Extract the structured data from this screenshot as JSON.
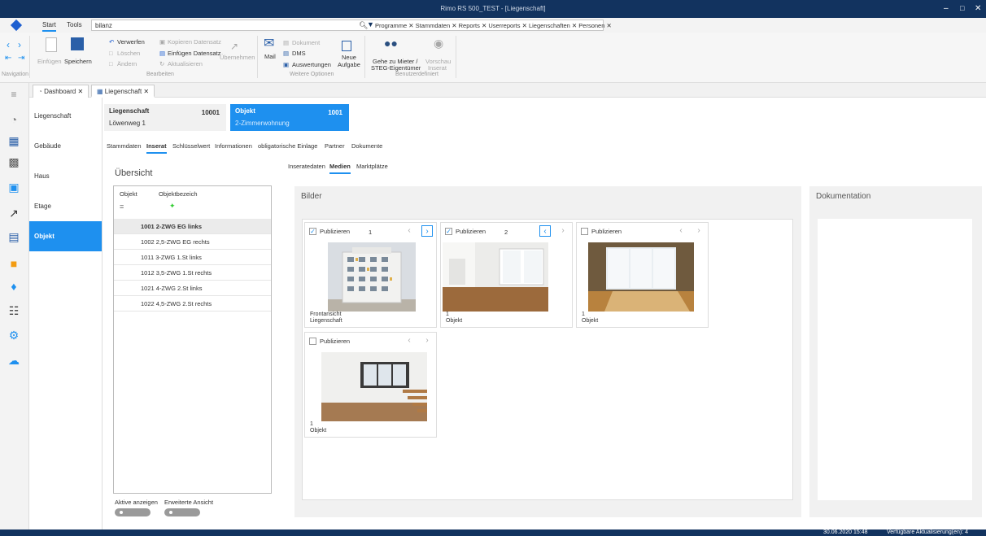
{
  "window": {
    "title": "Rimo RS 500_TEST - [Liegenschaft]",
    "controls": [
      "–",
      "□",
      "✕"
    ]
  },
  "menu": {
    "tabs": [
      "Start",
      "Tools"
    ],
    "search_value": "bilanz",
    "filters": "Programme ✕ Stammdaten ✕ Reports ✕ Userreports ✕ Liegenschaften ✕ Personen ✕"
  },
  "ribbon": {
    "navigation_group": "Navigation",
    "einfuegen": "Einfügen",
    "speichern": "Speichern",
    "verwerfen": "Verwerfen",
    "loeschen": "Löschen",
    "aendern": "Ändern",
    "kopieren": "Kopieren Datensatz",
    "einfuegen_datensatz": "Einfügen Datensatz",
    "aktualisieren": "Aktualisieren",
    "bearbeiten_group": "Bearbeiten",
    "uebernehmen": "Übernehmen",
    "mail": "Mail",
    "dokument": "Dokument",
    "dms": "DMS",
    "auswertungen": "Auswertungen",
    "neue": "Neue",
    "aufgabe": "Aufgabe",
    "weitere_group": "Weitere Optionen",
    "gehe_zu": "Gehe zu Mieter /",
    "steg": "STEG-Eigentümer",
    "vorschau": "Vorschau",
    "inserat": "Inserat",
    "benutzer_group": "Benutzerdefiniert"
  },
  "doctabs": [
    {
      "label": "Dashboard"
    },
    {
      "label": "Liegenschaft"
    }
  ],
  "nav": [
    {
      "label": "Liegenschaft"
    },
    {
      "label": "Gebäude"
    },
    {
      "label": "Haus"
    },
    {
      "label": "Etage"
    },
    {
      "label": "Objekt"
    }
  ],
  "header": {
    "liegenschaft_title": "Liegenschaft",
    "liegenschaft_num": "10001",
    "liegenschaft_sub": "Löwenweg 1",
    "objekt_title": "Objekt",
    "objekt_num": "1001",
    "objekt_sub": "2-Zimmerwohnung"
  },
  "subtabs": [
    "Stammdaten",
    "Inserat",
    "Schlüsselwert",
    "Informationen",
    "obligatorische Einlage",
    "Partner",
    "Dokumente"
  ],
  "subtabs2": [
    "Inseratedaten",
    "Medien",
    "Marktplätze"
  ],
  "overview": {
    "title": "Übersicht",
    "col1": "Objekt",
    "col2": "Objektbezeich",
    "rows": [
      "1001 2-ZWG EG links",
      "1002 2,5-ZWG EG rechts",
      "1011 3-ZWG 1.St links",
      "1012 3,5-ZWG 1.St rechts",
      "1021 4-ZWG 2.St links",
      "1022 4,5-ZWG 2.St rechts"
    ],
    "aktive": "Aktive anzeigen",
    "erweiterte": "Erweiterte Ansicht"
  },
  "bilder": {
    "title": "Bilder",
    "cards": [
      {
        "pub": "Publizieren",
        "num": "1",
        "checked": "✓",
        "cap1": "Frontansicht",
        "cap2": "Liegenschaft"
      },
      {
        "pub": "Publizieren",
        "num": "2",
        "checked": "✓",
        "cap1": "1",
        "cap2": "Objekt"
      },
      {
        "pub": "Publizieren",
        "num": "",
        "checked": "",
        "cap1": "1",
        "cap2": "Objekt"
      },
      {
        "pub": "Publizieren",
        "num": "",
        "checked": "",
        "cap1": "1",
        "cap2": "Objekt"
      }
    ]
  },
  "doku": {
    "title": "Dokumentation"
  },
  "status": {
    "datetime": "30.06.2020 15:48",
    "updates": "Verfügbare Aktualisierung(en): 4"
  },
  "colors": {
    "accent": "#1e90ef",
    "titlebar": "#12335f"
  }
}
